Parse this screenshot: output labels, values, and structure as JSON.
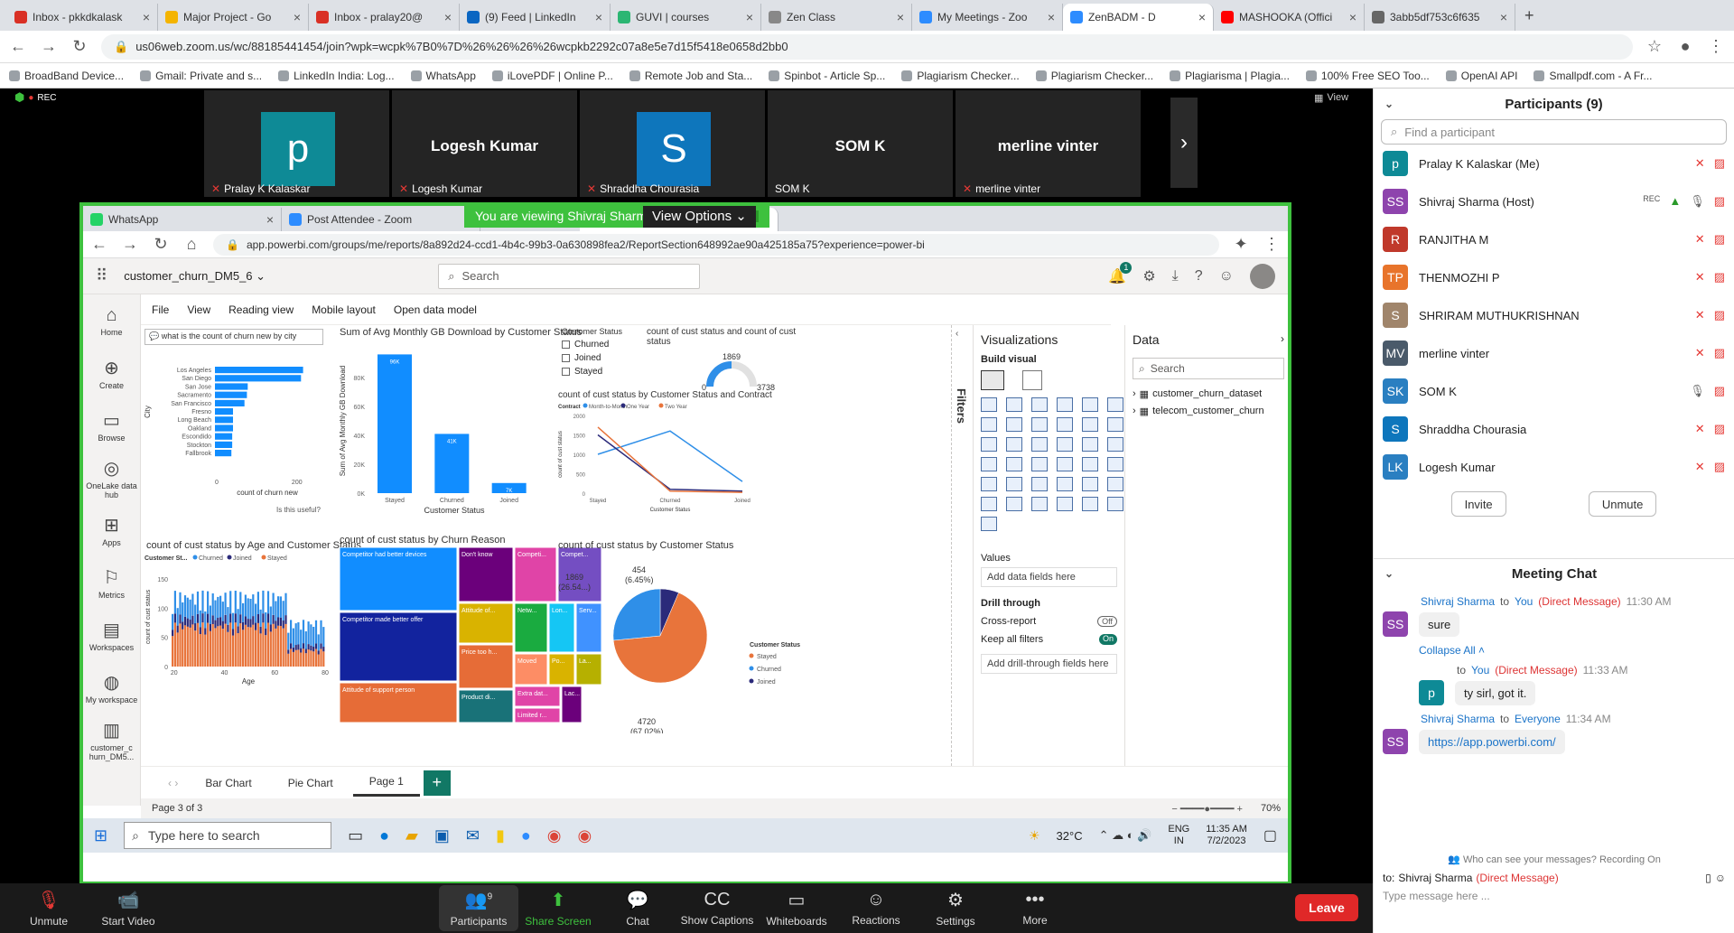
{
  "browser": {
    "tabs": [
      {
        "label": "Inbox - pkkdkalask",
        "icon": "gmail-icon",
        "color": "#d93025"
      },
      {
        "label": "Major Project - Go",
        "icon": "drive-icon",
        "color": "#f4b400"
      },
      {
        "label": "Inbox - pralay20@",
        "icon": "gmail-icon",
        "color": "#d93025"
      },
      {
        "label": "(9) Feed | LinkedIn",
        "icon": "linkedin-icon",
        "color": "#0a66c2"
      },
      {
        "label": "GUVI | courses",
        "icon": "guvi-icon",
        "color": "#2bb673"
      },
      {
        "label": "Zen Class",
        "icon": "page-icon",
        "color": "#888888"
      },
      {
        "label": "My Meetings - Zoo",
        "icon": "zoom-icon",
        "color": "#2d8cff"
      },
      {
        "label": "ZenBADM - D",
        "icon": "zoom-icon",
        "color": "#2d8cff"
      },
      {
        "label": "MASHOOKA (Offici",
        "icon": "youtube-icon",
        "color": "#ff0000"
      },
      {
        "label": "3abb5df753c6f635",
        "icon": "globe-icon",
        "color": "#666666"
      }
    ],
    "url": "us06web.zoom.us/wc/88185441454/join?wpk=wcpk%7B0%7D%26%26%26%26wcpkb2292c07a8e5e7d15f5418e0658d2bb0",
    "bookmarks": [
      "BroadBand Device...",
      "Gmail: Private and s...",
      "LinkedIn India: Log...",
      "WhatsApp",
      "iLovePDF | Online P...",
      "Remote Job and Sta...",
      "Spinbot - Article Sp...",
      "Plagiarism Checker...",
      "Plagiarism Checker...",
      "Plagiarisma | Plagia...",
      "100% Free SEO Too...",
      "OpenAI API",
      "Smallpdf.com - A Fr..."
    ]
  },
  "zoom": {
    "rec": "REC",
    "view": "View",
    "thumbnails": [
      {
        "display": "p",
        "name": "Pralay K Kalaskar",
        "color": "#0e8a96"
      },
      {
        "display": "Logesh Kumar",
        "name": "Logesh Kumar"
      },
      {
        "display": "S",
        "name": "Shraddha Chourasia",
        "color": "#0e76bc"
      },
      {
        "display": "SOM K",
        "name": "SOM K"
      },
      {
        "display": "merline vinter",
        "name": "merline vinter"
      }
    ],
    "viewing_banner": "You are viewing Shivraj Sharma's screen",
    "view_options": "View Options",
    "toolbar": [
      {
        "label": "Unmute",
        "icon": "mic-off-icon"
      },
      {
        "label": "Start Video",
        "icon": "video-off-icon"
      },
      {
        "label": "Participants",
        "icon": "participants-icon",
        "count": "9"
      },
      {
        "label": "Share Screen",
        "icon": "share-screen-icon"
      },
      {
        "label": "Chat",
        "icon": "chat-icon"
      },
      {
        "label": "Show Captions",
        "icon": "captions-icon"
      },
      {
        "label": "Whiteboards",
        "icon": "whiteboard-icon"
      },
      {
        "label": "Reactions",
        "icon": "reactions-icon"
      },
      {
        "label": "Settings",
        "icon": "settings-icon"
      },
      {
        "label": "More",
        "icon": "more-icon"
      }
    ],
    "leave": "Leave"
  },
  "shared": {
    "tabs": [
      {
        "label": "WhatsApp",
        "color": "#25d366"
      },
      {
        "label": "Post Attendee - Zoom",
        "color": "#2d8cff"
      },
      {
        "label": "customer_churn_DM5_6 - Po",
        "color": "#f2c811"
      }
    ],
    "url": "app.powerbi.com/groups/me/reports/8a892d24-ccd1-4b4c-99b3-0a630898fea2/ReportSection648992ae90a425185a75?experience=power-bi",
    "report_name": "customer_churn_DM5_6",
    "search_placeholder": "Search",
    "notif_count": "1",
    "rail": [
      {
        "label": "Home",
        "icon": "home-icon"
      },
      {
        "label": "Create",
        "icon": "create-icon"
      },
      {
        "label": "Browse",
        "icon": "browse-icon"
      },
      {
        "label": "OneLake data hub",
        "icon": "onelake-icon"
      },
      {
        "label": "Apps",
        "icon": "apps-icon"
      },
      {
        "label": "Metrics",
        "icon": "metrics-icon"
      },
      {
        "label": "Workspaces",
        "icon": "workspaces-icon"
      },
      {
        "label": "My workspace",
        "icon": "my-workspace-icon"
      },
      {
        "label": "customer_c hurn_DM5...",
        "icon": "report-icon"
      }
    ],
    "menu": [
      "File",
      "View",
      "Reading view",
      "Mobile layout",
      "Open data model"
    ],
    "qa_text": "what is the count of churn new by city",
    "qa_footer": "Is this useful?",
    "visuals": {
      "city_xlabel": "count of churn new",
      "city_ylabel": "City",
      "gb_title": "Sum of Avg Monthly GB Download by Customer Status",
      "gb_ylabel": "Sum of Avg Monthly GB Download",
      "gb_xlabel": "Customer Status",
      "slicer_title": "Customer Status",
      "slicer_items": [
        "Churned",
        "Joined",
        "Stayed"
      ],
      "gauge_title": "count of cust status and count of cust status",
      "gauge_value": "1869",
      "gauge_min": "0",
      "gauge_max": "3738",
      "contract_title": "count of cust status by Customer Status and Contract",
      "contract_legend_label": "Contract",
      "contract_ylabel": "count of cust status",
      "contract_xlabel": "Customer Status",
      "age_title": "count of cust status by Age and Customer Status",
      "age_legend_label": "Customer St...",
      "age_ylabel": "count of cust status",
      "age_xlabel": "Age",
      "treemap_title": "count of cust status by Churn Reason",
      "pie_title": "count of cust status by Customer Status",
      "pie_legend_label": "Customer Status"
    },
    "panes": {
      "filters": "Filters",
      "viz_title": "Visualizations",
      "build_visual": "Build visual",
      "values_label": "Values",
      "add_data": "Add data fields here",
      "drill_through": "Drill through",
      "cross_report": "Cross-report",
      "cross_report_state": "Off",
      "keep_filters": "Keep all filters",
      "keep_filters_state": "On",
      "add_drill": "Add drill-through fields here",
      "data_title": "Data",
      "data_search": "Search",
      "tables": [
        "customer_churn_dataset",
        "telecom_customer_churn"
      ]
    },
    "pages": [
      "Bar Chart",
      "Pie Chart",
      "Page 1"
    ],
    "page_status": "Page 3 of 3",
    "zoom_level": "70%",
    "taskbar": {
      "search": "Type here to search",
      "weather": "32°C",
      "lang": "ENG",
      "region": "IN",
      "time": "11:35 AM",
      "date": "7/2/2023"
    }
  },
  "chart_data": [
    {
      "type": "bar",
      "orientation": "horizontal",
      "categories": [
        "Los Angeles",
        "San Diego",
        "San Jose",
        "Sacramento",
        "San Francisco",
        "Fresno",
        "Long Beach",
        "Oakland",
        "Escondido",
        "Stockton",
        "Fallbrook"
      ],
      "values": [
        215,
        210,
        80,
        78,
        72,
        44,
        44,
        44,
        42,
        42,
        40
      ],
      "xlabel": "count of churn new",
      "ylabel": "City",
      "xticks": [
        "0",
        "200"
      ],
      "xlim": [
        0,
        260
      ]
    },
    {
      "type": "bar",
      "categories": [
        "Stayed",
        "Churned",
        "Joined"
      ],
      "values": [
        96000,
        41000,
        7000
      ],
      "data_labels": [
        "96K",
        "41K",
        "7K"
      ],
      "title": "Sum of Avg Monthly GB Download by Customer Status",
      "xlabel": "Customer Status",
      "ylabel": "Sum of Avg Monthly GB Download",
      "yticks": [
        "0K",
        "20K",
        "40K",
        "60K",
        "80K"
      ],
      "ylim": [
        0,
        100000
      ]
    },
    {
      "type": "line",
      "title": "count of cust status by Customer Status and Contract",
      "categories": [
        "Stayed",
        "Churned",
        "Joined"
      ],
      "xlabel": "Customer Status",
      "ylabel": "count of cust status",
      "yticks": [
        "0",
        "500",
        "1000",
        "1500",
        "2000"
      ],
      "ylim": [
        0,
        2000
      ],
      "series": [
        {
          "name": "Month-to-Month",
          "values": [
            1000,
            1600,
            300
          ],
          "color": "#2f8fe8"
        },
        {
          "name": "One Year",
          "values": [
            1500,
            100,
            50
          ],
          "color": "#2b2a7a"
        },
        {
          "name": "Two Year",
          "values": [
            1700,
            50,
            20
          ],
          "color": "#e8743b"
        }
      ]
    },
    {
      "type": "bar",
      "stacked": true,
      "title": "count of cust status by Age and Customer Status",
      "xlabel": "Age",
      "ylabel": "count of cust status",
      "xticks": [
        "20",
        "40",
        "60",
        "80"
      ],
      "yticks": [
        "0",
        "50",
        "100",
        "150"
      ],
      "xlim": [
        19,
        80
      ],
      "ylim": [
        0,
        170
      ],
      "series": [
        {
          "name": "Churned",
          "color": "#2f8fe8"
        },
        {
          "name": "Joined",
          "color": "#2b2a7a"
        },
        {
          "name": "Stayed",
          "color": "#e8743b"
        }
      ]
    },
    {
      "type": "heatmap",
      "subtype": "treemap",
      "title": "count of cust status by Churn Reason",
      "categories": [
        "Competitor had better devices",
        "Don't know",
        "Competi...",
        "Compet...",
        "Competitor made better offer",
        "Attitude of...",
        "Netw...",
        "Lon...",
        "Serv...",
        "Price too h...",
        "Moved",
        "Po...",
        "La...",
        "Attitude of support person",
        "Product di...",
        "Extra dat...",
        "Lac...",
        "Limited r..."
      ]
    },
    {
      "type": "pie",
      "title": "count of cust status by Customer Status",
      "categories": [
        "Stayed",
        "Churned",
        "Joined"
      ],
      "values": [
        4720,
        1869,
        454
      ],
      "data_labels": [
        "4720 (67.02%)",
        "1869 (26.54...)",
        "454 (6.45%)"
      ],
      "colors": [
        "#e8743b",
        "#2f8fe8",
        "#2b2a7a"
      ]
    }
  ],
  "panel": {
    "participants_title": "Participants (9)",
    "find_placeholder": "Find a participant",
    "participants": [
      {
        "initials": "p",
        "name": "Pralay K Kalaskar (Me)",
        "color": "#0e8a96",
        "mic": "muted"
      },
      {
        "initials": "SS",
        "name": "Shivraj Sharma (Host)",
        "color": "#8e44ad",
        "mic": "on",
        "rec": "REC"
      },
      {
        "initials": "R",
        "name": "RANJITHA M",
        "color": "#c0392b",
        "mic": "muted"
      },
      {
        "initials": "TP",
        "name": "THENMOZHI P",
        "color": "#e8742b",
        "mic": "muted"
      },
      {
        "initials": "S",
        "name": "SHRIRAM MUTHUKRISHNAN",
        "color": "#a0856b",
        "mic": "muted"
      },
      {
        "initials": "MV",
        "name": "merline vinter",
        "color": "#4a5a6a",
        "mic": "muted"
      },
      {
        "initials": "SK",
        "name": "SOM K",
        "color": "#2a7fc1",
        "mic": "on"
      },
      {
        "initials": "S",
        "name": "Shraddha Chourasia",
        "color": "#0e76bc",
        "mic": "muted"
      },
      {
        "initials": "LK",
        "name": "Logesh Kumar",
        "color": "#2a7fc1",
        "mic": "muted"
      }
    ],
    "invite": "Invite",
    "unmute": "Unmute",
    "chat_title": "Meeting Chat",
    "messages": [
      {
        "from": "Shivraj Sharma",
        "to": "You",
        "dm": "(Direct Message)",
        "time": "11:30 AM",
        "text": "sure",
        "initials": "SS",
        "color": "#8e44ad"
      },
      {
        "from": "",
        "to": "You",
        "dm": "(Direct Message)",
        "time": "11:33 AM",
        "text": "ty sirl, got it.",
        "initials": "p",
        "color": "#0e8a96"
      },
      {
        "from": "Shivraj Sharma",
        "to": "Everyone",
        "dm": "",
        "time": "11:34 AM",
        "text": "https://app.powerbi.com/",
        "initials": "SS",
        "color": "#8e44ad"
      }
    ],
    "to_word": "to",
    "collapse_all": "Collapse All",
    "visibility_note": "Who can see your messages? Recording On",
    "to_label": "to:",
    "to_name": "Shivraj Sharma",
    "to_dm": "(Direct Message)",
    "input_placeholder": "Type message here ..."
  }
}
